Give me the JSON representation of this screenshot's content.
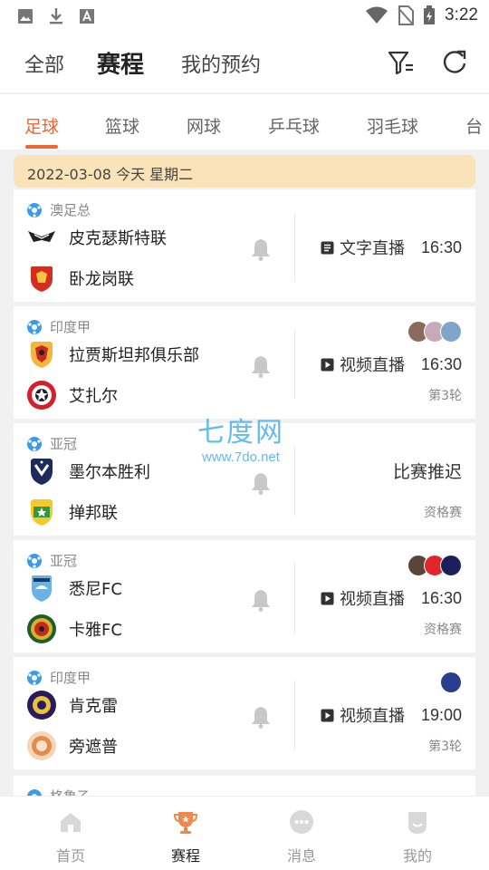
{
  "statusbar": {
    "time": "3:22"
  },
  "topnav": {
    "tabs": [
      "全部",
      "赛程",
      "我的预约"
    ],
    "active_index": 1
  },
  "sports": {
    "tabs": [
      "足球",
      "篮球",
      "网球",
      "乒乓球",
      "羽毛球",
      "台"
    ],
    "active_index": 0
  },
  "date_banner": "2022-03-08  今天  星期二",
  "matches": [
    {
      "league": "澳足总",
      "home": "皮克瑟斯特联",
      "away": "卧龙岗联",
      "broadcast": "文字直播",
      "time": "16:30",
      "round": ""
    },
    {
      "league": "印度甲",
      "home": "拉贾斯坦邦俱乐部",
      "away": "艾扎尔",
      "broadcast": "视频直播",
      "time": "16:30",
      "round": "第3轮"
    },
    {
      "league": "亚冠",
      "home": "墨尔本胜利",
      "away": "掸邦联",
      "status": "比赛推迟",
      "round": "资格赛"
    },
    {
      "league": "亚冠",
      "home": "悉尼FC",
      "away": "卡雅FC",
      "broadcast": "视频直播",
      "time": "16:30",
      "round": "资格赛"
    },
    {
      "league": "印度甲",
      "home": "肯克雷",
      "away": "旁遮普",
      "broadcast": "视频直播",
      "time": "19:00",
      "round": "第3轮"
    }
  ],
  "next_league_peek": "格鲁乙",
  "watermark": {
    "title": "七度网",
    "url": "www.7do.net"
  },
  "bottomnav": {
    "items": [
      "首页",
      "赛程",
      "消息",
      "我的"
    ],
    "active_index": 1
  },
  "colors": {
    "accent": "#ee6633",
    "date_banner_bg": "#fae3b8",
    "watermark": "#31a5e8"
  }
}
